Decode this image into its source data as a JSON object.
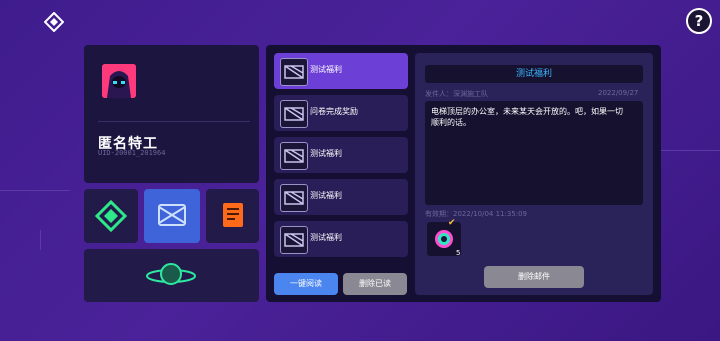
{
  "profile": {
    "name": "匿名特工",
    "uid": "UID-20001_201964"
  },
  "mails": [
    {
      "title": "测试福利",
      "selected": true
    },
    {
      "title": "问卷完成奖励",
      "selected": false
    },
    {
      "title": "测试福利",
      "selected": false
    },
    {
      "title": "测试福利",
      "selected": false
    },
    {
      "title": "测试福利",
      "selected": false
    }
  ],
  "buttons": {
    "read_all": "一键阅读",
    "delete_read": "删除已读",
    "delete_mail": "删除邮件"
  },
  "detail": {
    "title": "测试福利",
    "sender": "发件人：深渊施工队",
    "date": "2022/09/27",
    "body": "电梯顶层的办公室，未来某天会开放的。吧，如果一切顺利的话。",
    "expire": "有效期：2022/10/04 11:35:09",
    "attachment_count": "5"
  },
  "help": {
    "label": "?"
  },
  "colors": {
    "accent": "#6c3fd6",
    "title_blue": "#3bb6ff",
    "read_all_btn": "#4b86f0"
  }
}
